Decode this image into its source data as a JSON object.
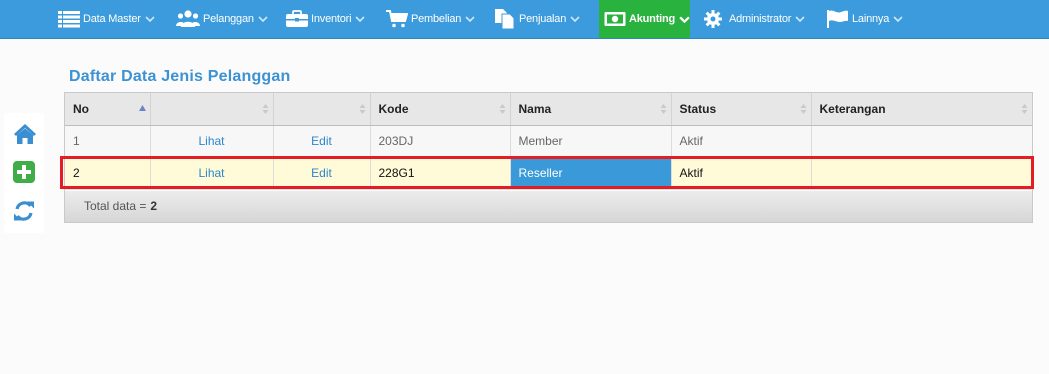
{
  "nav": {
    "items": [
      {
        "label": "Data Master",
        "icon": "list-icon"
      },
      {
        "label": "Pelanggan",
        "icon": "users-icon"
      },
      {
        "label": "Inventori",
        "icon": "briefcase-icon"
      },
      {
        "label": "Pembelian",
        "icon": "cart-icon"
      },
      {
        "label": "Penjualan",
        "icon": "document-icon"
      },
      {
        "label": "Akunting",
        "icon": "money-icon",
        "active": true
      },
      {
        "label": "Administrator",
        "icon": "gear-icon"
      },
      {
        "label": "Lainnya",
        "icon": "flag-icon"
      }
    ]
  },
  "sidebar": {
    "buttons": [
      "home-icon",
      "add-icon",
      "refresh-icon"
    ]
  },
  "page": {
    "title": "Daftar Data Jenis Pelanggan"
  },
  "table": {
    "columns": [
      "No",
      "",
      "",
      "Kode",
      "Nama",
      "Status",
      "Keterangan"
    ],
    "rows": [
      {
        "no": "1",
        "view": "Lihat",
        "edit": "Edit",
        "kode": "203DJ",
        "nama": "Member",
        "status": "Aktif",
        "keterangan": ""
      },
      {
        "no": "2",
        "view": "Lihat",
        "edit": "Edit",
        "kode": "228G1",
        "nama": "Reseller",
        "status": "Aktif",
        "keterangan": ""
      }
    ],
    "footer_label": "Total data =",
    "footer_value": "2"
  },
  "colors": {
    "nav_bg": "#3c9bdc",
    "nav_active": "#29b33e",
    "title": "#3c92d2",
    "highlight": "#e41c24",
    "selected_cell": "#3a99d8"
  }
}
